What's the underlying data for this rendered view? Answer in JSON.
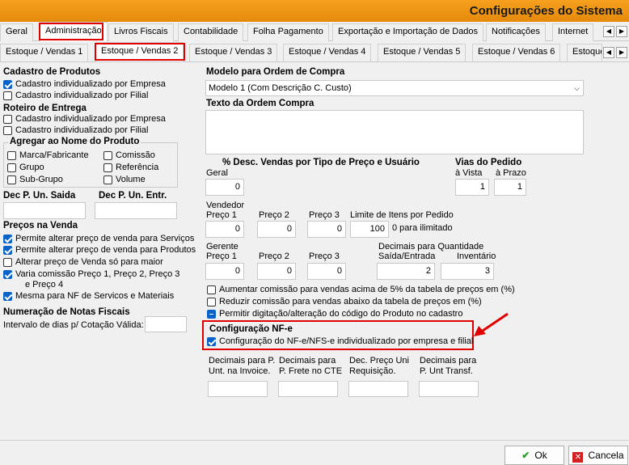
{
  "window": {
    "title": "Configurações do Sistema"
  },
  "tabs1": [
    "Geral",
    "Administração",
    "Livros Fiscais",
    "Contabilidade",
    "Folha Pagamento",
    "Exportação e Importação de Dados",
    "Notificações",
    "Internet"
  ],
  "tabs2": [
    "Estoque / Vendas 1",
    "Estoque / Vendas 2",
    "Estoque / Vendas 3",
    "Estoque / Vendas 4",
    "Estoque / Vendas 5",
    "Estoque / Vendas 6",
    "Estoque"
  ],
  "cadastro": {
    "title": "Cadastro de Produtos",
    "opt1": "Cadastro individualizado por Empresa",
    "opt2": "Cadastro individualizado por Filial",
    "opt1_checked": true,
    "opt2_checked": false
  },
  "roteiro": {
    "title": "Roteiro de Entrega",
    "opt1": "Cadastro individualizado por Empresa",
    "opt2": "Cadastro individualizado por Filial"
  },
  "agregar": {
    "title": "Agregar ao Nome do Produto",
    "items": [
      "Marca/Fabricante",
      "Comissão",
      "Grupo",
      "Referência",
      "Sub-Grupo",
      "Volume"
    ]
  },
  "dec": {
    "saida": "Dec P. Un. Saida",
    "entr": "Dec P. Un. Entr."
  },
  "precos": {
    "title": "Preços na Venda",
    "o1": "Permite alterar preço de venda  para Serviços",
    "o2": "Permite alterar preço de venda para Produtos",
    "o3": "Alterar preço de Venda só para maior",
    "o4a": "Varia comissão Preço 1, Preço 2, Preço 3",
    "o4b": "e Preço 4",
    "o5": "Mesma para NF de Servicos e Materiais"
  },
  "numeracao": {
    "title": "Numeração de Notas Fiscais",
    "intervalo": "Intervalo de dias p/ Cotação Válida:"
  },
  "modelo": {
    "title": "Modelo para Ordem de Compra",
    "value": "Modelo 1 (Com Descrição C. Custo)",
    "texto": "Texto da Ordem Compra"
  },
  "desc": {
    "title": "% Desc. Vendas por Tipo de Preço e Usuário",
    "geral": "Geral",
    "geral_v": "0",
    "vendedor": "Vendedor",
    "gerente": "Gerente",
    "preco1": "Preço 1",
    "preco2": "Preço 2",
    "preco3": "Preço 3",
    "v1": "0",
    "v2": "0",
    "v3": "0",
    "g1": "0",
    "g2": "0",
    "g3": "0"
  },
  "vias": {
    "title": "Vias do Pedido",
    "avista": "à Vista",
    "aprazo": "à Prazo",
    "v1": "1",
    "v2": "1"
  },
  "limite": {
    "label": "Limite de Itens por Pedido",
    "value": "100",
    "hint": "0 para ilimitado"
  },
  "decimais": {
    "label": "Decimais para Quantidade",
    "saida": "Saída/Entrada",
    "inv": "Inventário",
    "v1": "2",
    "v2": "3"
  },
  "opts": {
    "a": "Aumentar comissão para vendas acima de 5% da tabela de preços em (%)",
    "b": "Reduzir comissão para vendas abaixo da tabela de preços em (%)",
    "c": "Permitir digitação/alteração do código do Produto no cadastro"
  },
  "nfe": {
    "title": "Configuração NF-e",
    "opt": "Configuração do NF-e/NFS-e individualizado por empresa e filial"
  },
  "bottom": {
    "l1a": "Decimais para P.",
    "l1b": "Unt. na Invoice.",
    "l2a": "Decimais para",
    "l2b": "P. Frete no CTE",
    "l3a": "Dec. Preço Uni",
    "l3b": "Requisição.",
    "l4a": "Decimais para",
    "l4b": "P. Unt Transf."
  },
  "buttons": {
    "ok": "Ok",
    "cancel": "Cancela"
  },
  "colors": {
    "accent": "#f0961a",
    "highlight": "#e00000",
    "check": "#0a64c8"
  }
}
